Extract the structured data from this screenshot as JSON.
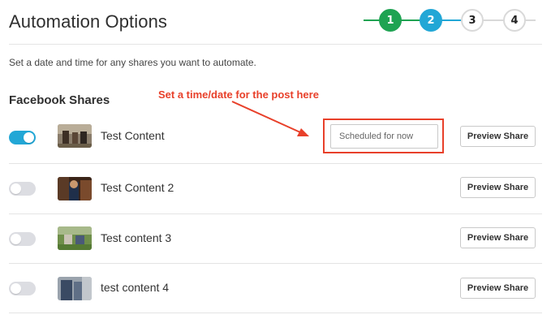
{
  "header": {
    "title": "Automation Options",
    "steps": [
      "1",
      "2",
      "3",
      "4"
    ],
    "step_colors": {
      "done": "#1fa352",
      "active": "#22a7d6",
      "pending": "#d9d9d9"
    }
  },
  "subtitle": "Set a date and time for any shares you want to automate.",
  "section_title": "Facebook Shares",
  "annotation": {
    "text": "Set a time/date for the post here",
    "color": "#e8402a"
  },
  "schedule": {
    "placeholder": "Scheduled for now"
  },
  "shares": [
    {
      "label": "Test Content",
      "enabled": true,
      "preview_label": "Preview Share"
    },
    {
      "label": "Test Content 2",
      "enabled": false,
      "preview_label": "Preview Share"
    },
    {
      "label": "Test content 3",
      "enabled": false,
      "preview_label": "Preview Share"
    },
    {
      "label": "test content 4",
      "enabled": false,
      "preview_label": "Preview Share"
    }
  ]
}
